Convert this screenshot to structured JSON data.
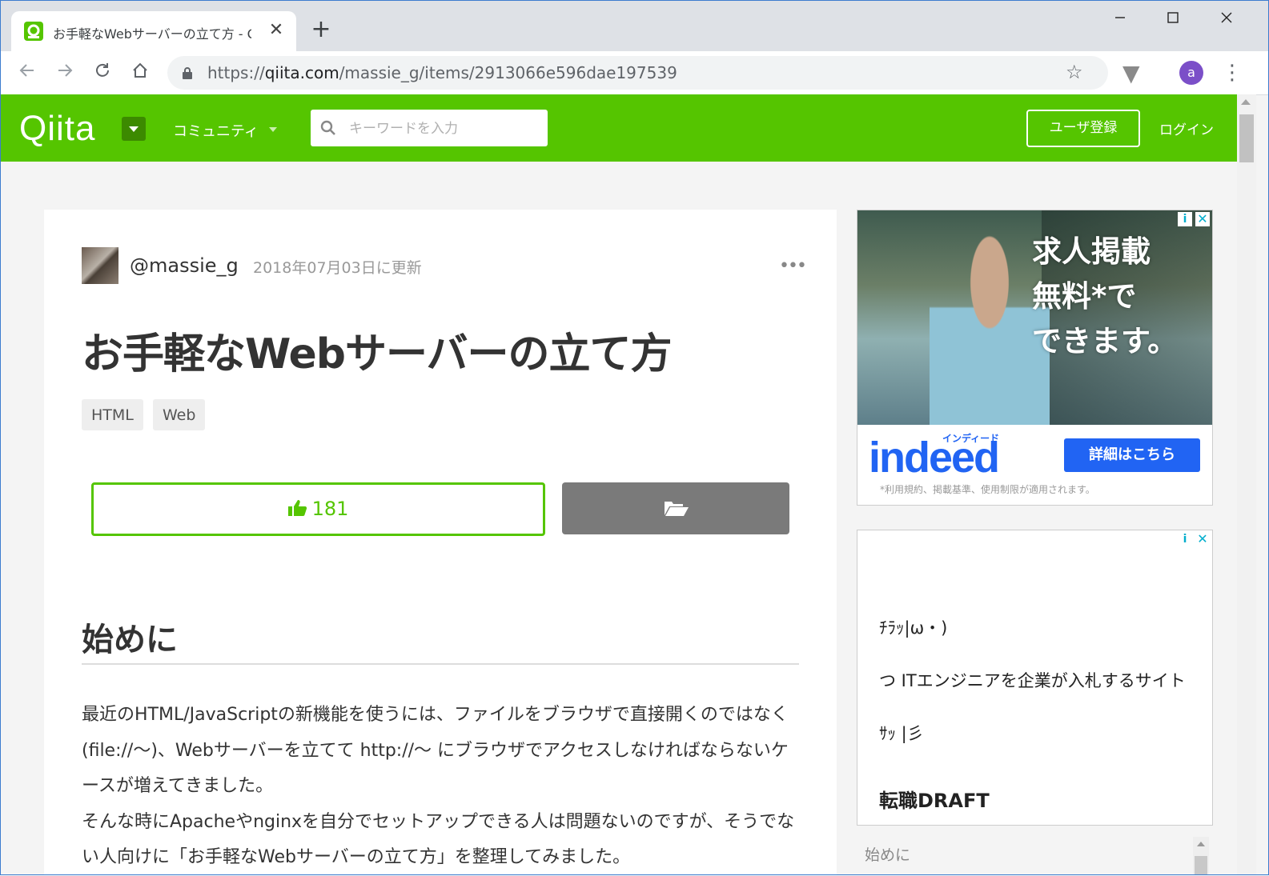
{
  "browser": {
    "tab_title": "お手軽なWebサーバーの立て方 - Qiita",
    "tab_close": "✕",
    "new_tab": "+",
    "url_scheme": "https://",
    "url_host": "qiita.com",
    "url_path": "/massie_g/items/2913066e596dae197539",
    "profile_initial": "a",
    "icons": [
      "back-arrow-icon",
      "forward-arrow-icon",
      "reload-icon",
      "home-icon",
      "lock-icon",
      "bookmark-star-icon",
      "extension-v-icon",
      "menu-dots-icon",
      "minimize-icon",
      "maximize-icon",
      "close-icon"
    ]
  },
  "header": {
    "logo": "Qiita",
    "community": "コミュニティ",
    "search_placeholder": "キーワードを入力",
    "signup": "ユーザ登録",
    "login": "ログイン",
    "brand_color": "#55c500"
  },
  "article": {
    "author": "@massie_g",
    "updated": "2018年07月03日に更新",
    "more": "•••",
    "title": "お手軽なWebサーバーの立て方",
    "tags": [
      "HTML",
      "Web"
    ],
    "like_count": "181",
    "heading1": "始めに",
    "paragraph_lines": [
      "最近のHTML/JavaScriptの新機能を使うには、ファイルをブラウザで直接開くのではなく(file://〜)、Webサーバーを立てて http://〜 にブラウザでアクセスしなければならないケースが増えてきました。",
      "そんな時にApacheやnginxを自分でセットアップできる人は問題ないのですが、そうでない人向けに「お手軽なWebサーバーの立て方」を整理してみました。"
    ]
  },
  "ads": {
    "ad1": {
      "copy_lines": [
        "求人掲載",
        "無料*で",
        "できます。"
      ],
      "brand_sub": "インディード",
      "brand": "indeed",
      "button": "詳細はこちら",
      "note": "*利用規約、掲載基準、使用制限が適用されます。",
      "info": "i",
      "close": "✕"
    },
    "ad2": {
      "line1": "ﾁﾗｯ|ω・)",
      "line2": "つ ITエンジニアを企業が入札するサイト",
      "line3": "ｻｯ |彡",
      "line4": "転職DRAFT",
      "info": "i",
      "close": "✕"
    }
  },
  "sidebar": {
    "toc_first": "始めに"
  }
}
